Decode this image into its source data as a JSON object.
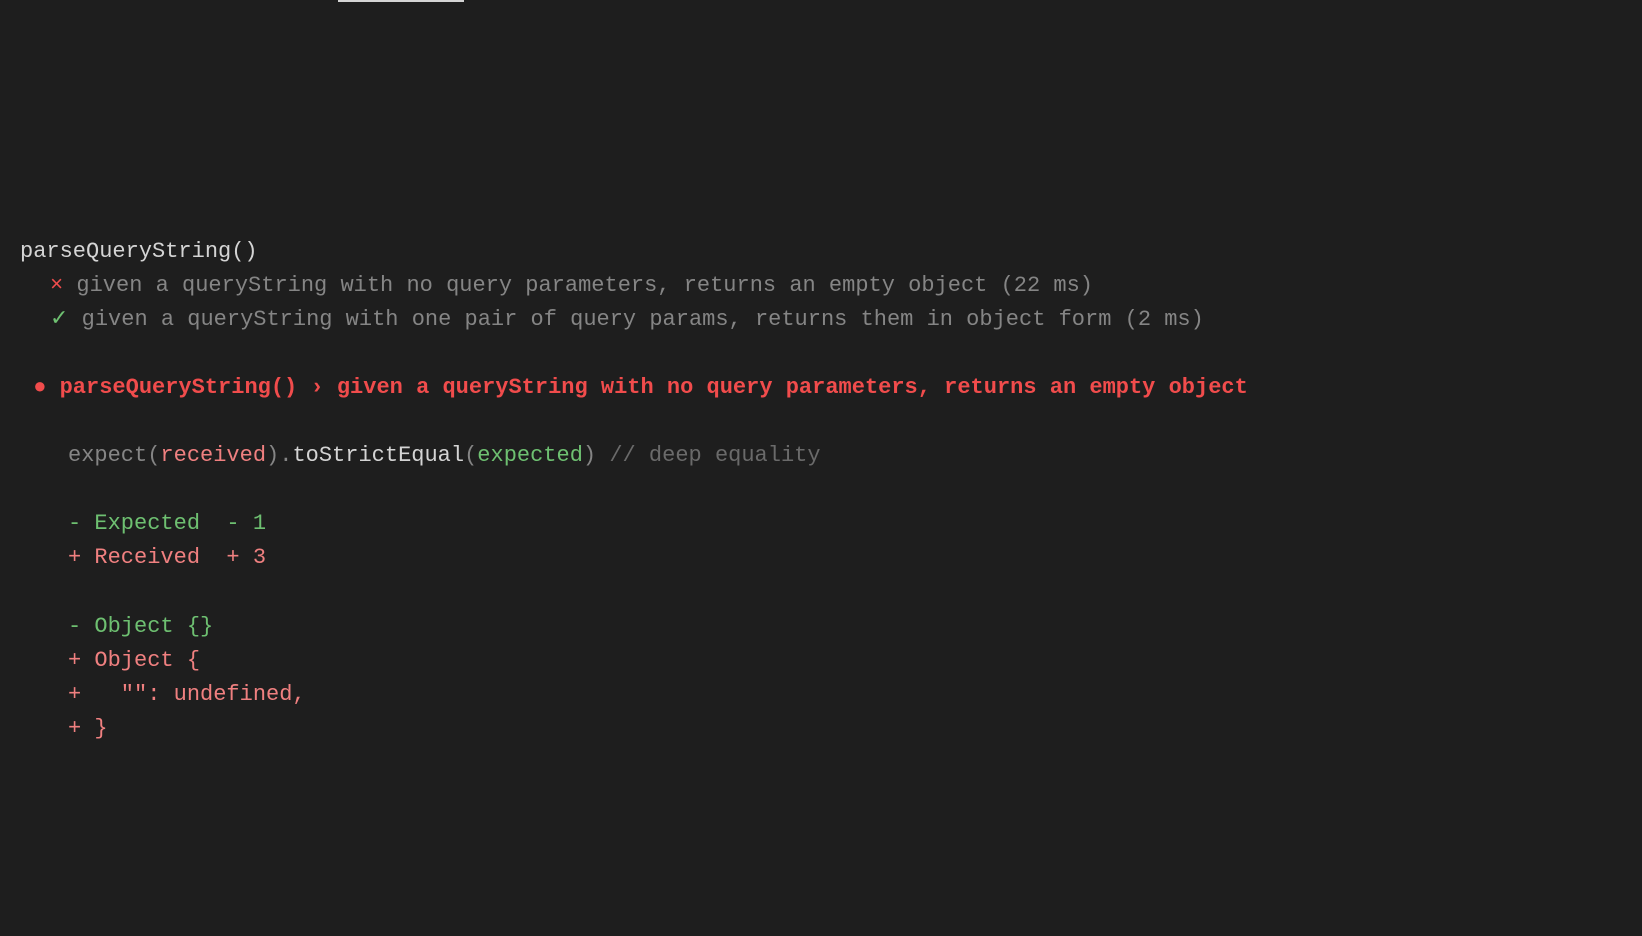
{
  "suite": {
    "title": "parseQueryString()",
    "tests": [
      {
        "status": "fail",
        "mark": "×",
        "name": "given a queryString with no query parameters, returns an empty object",
        "duration": "(22 ms)"
      },
      {
        "status": "pass",
        "mark": "✓",
        "name": "given a queryString with one pair of query params, returns them in object form",
        "duration": "(2 ms)"
      }
    ]
  },
  "failure": {
    "bullet": "●",
    "header": "parseQueryString() › given a queryString with no query parameters, returns an empty object",
    "expectLine": {
      "p1": "expect(",
      "received": "received",
      "p2": ").",
      "matcher": "toStrictEqual",
      "p3": "(",
      "expected": "expected",
      "p4": ") ",
      "comment": "// deep equality"
    },
    "summary": {
      "expected": "- Expected  - 1",
      "received": "+ Received  + 3"
    },
    "diff": [
      {
        "cls": "green",
        "text": "- Object {}"
      },
      {
        "cls": "red",
        "text": "+ Object {"
      },
      {
        "cls": "red",
        "text": "+   \"\": undefined,"
      },
      {
        "cls": "red",
        "text": "+ }"
      }
    ]
  }
}
